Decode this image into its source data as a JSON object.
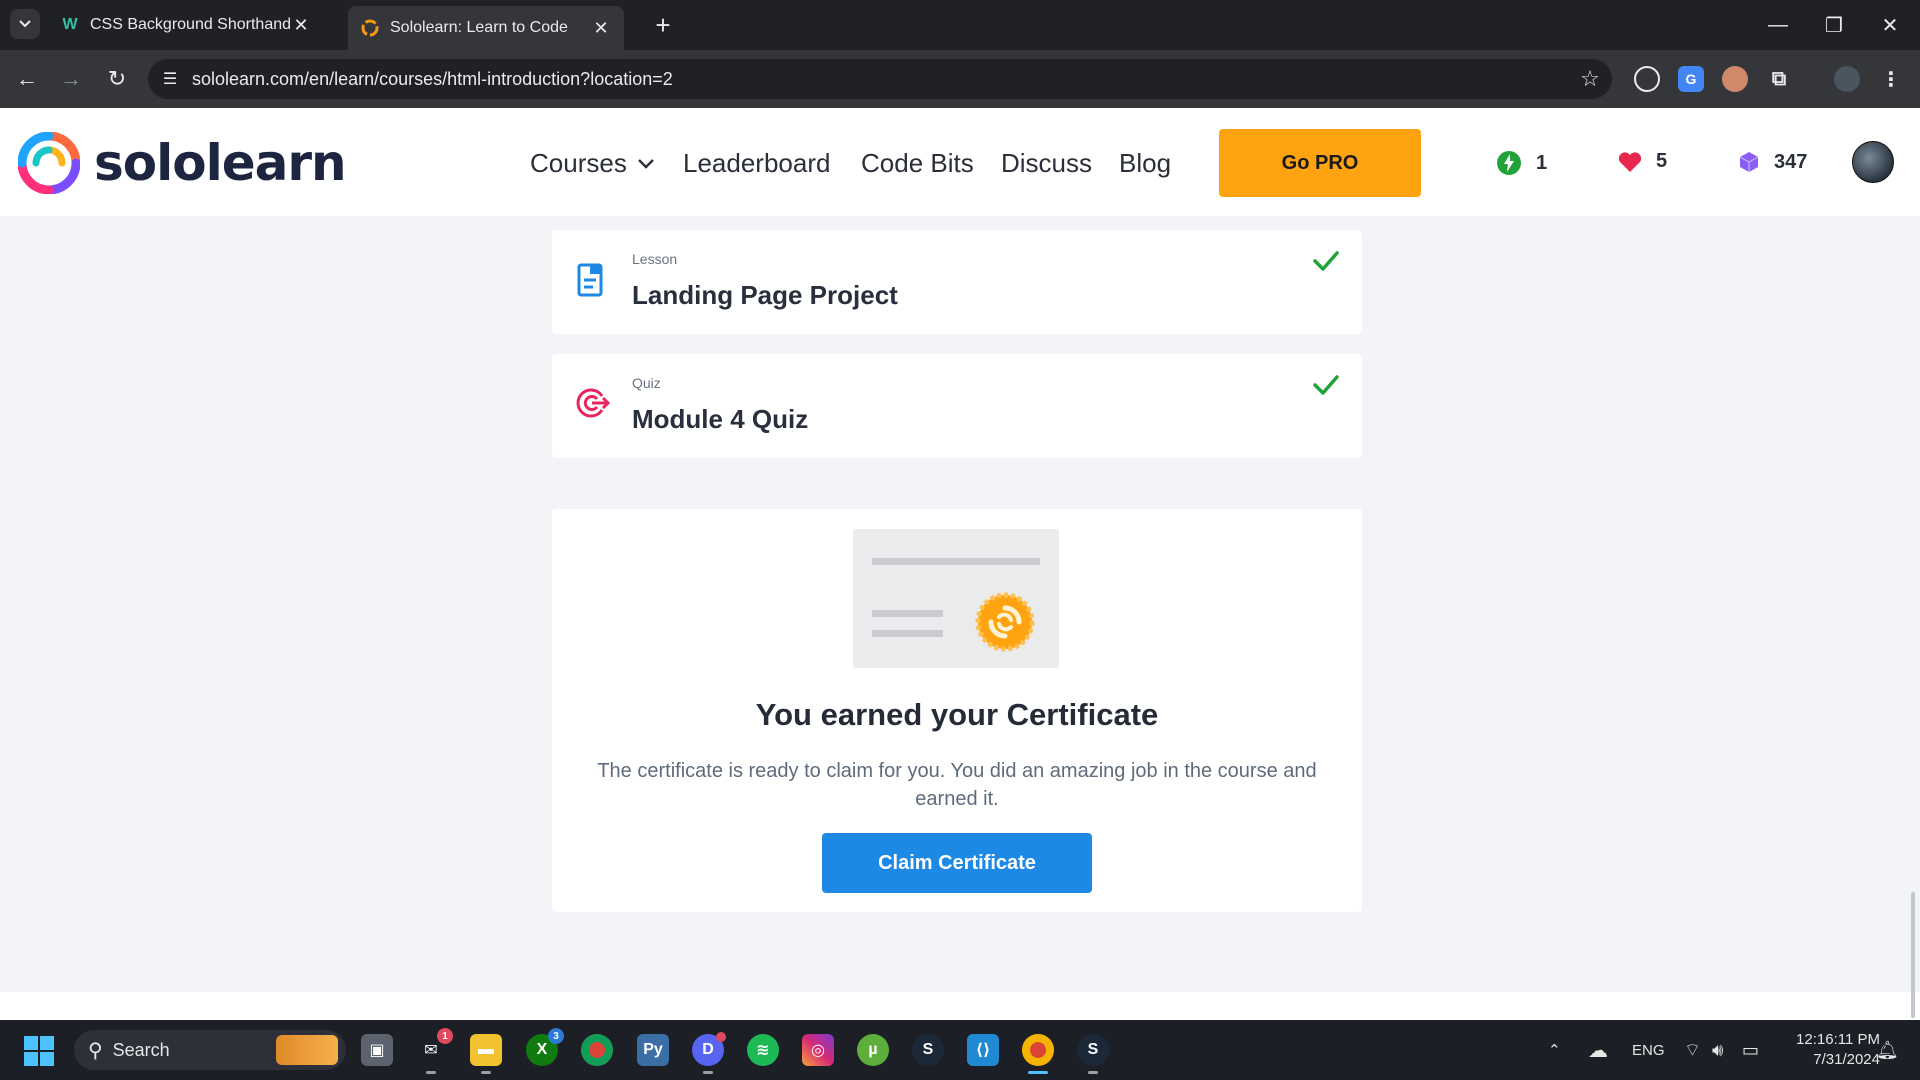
{
  "browser": {
    "tabs": [
      {
        "title": "CSS Background Shorthand",
        "active": false,
        "favicon": "w-favicon"
      },
      {
        "title": "Sololearn: Learn to Code",
        "active": true,
        "favicon": "sololearn-favicon"
      }
    ],
    "url": "sololearn.com/en/learn/courses/html-introduction?location=2"
  },
  "site": {
    "logo_text": "sololearn",
    "nav": {
      "courses": "Courses",
      "leaderboard": "Leaderboard",
      "code_bits": "Code Bits",
      "discuss": "Discuss",
      "blog": "Blog"
    },
    "go_pro": "Go PRO",
    "stats": {
      "streak": "1",
      "hearts": "5",
      "bits": "347"
    }
  },
  "lessons": [
    {
      "kind": "Lesson",
      "name": "Landing Page Project",
      "completed": true
    },
    {
      "kind": "Quiz",
      "name": "Module 4 Quiz",
      "completed": true
    }
  ],
  "certificate": {
    "title": "You earned your Certificate",
    "text": "The certificate is ready to claim for you. You did an amazing job in the course and earned it.",
    "button": "Claim Certificate"
  },
  "taskbar": {
    "search_label": "Search",
    "badges": {
      "mail": "1",
      "xbox": "3"
    },
    "language": "ENG",
    "time": "12:16:11 PM",
    "date": "7/31/2024"
  },
  "colors": {
    "accent_orange": "#ffa310",
    "accent_blue": "#1e88e5",
    "check_green": "#22a33a",
    "heart_red": "#e8264e",
    "bits_purple": "#8b5cf6"
  }
}
